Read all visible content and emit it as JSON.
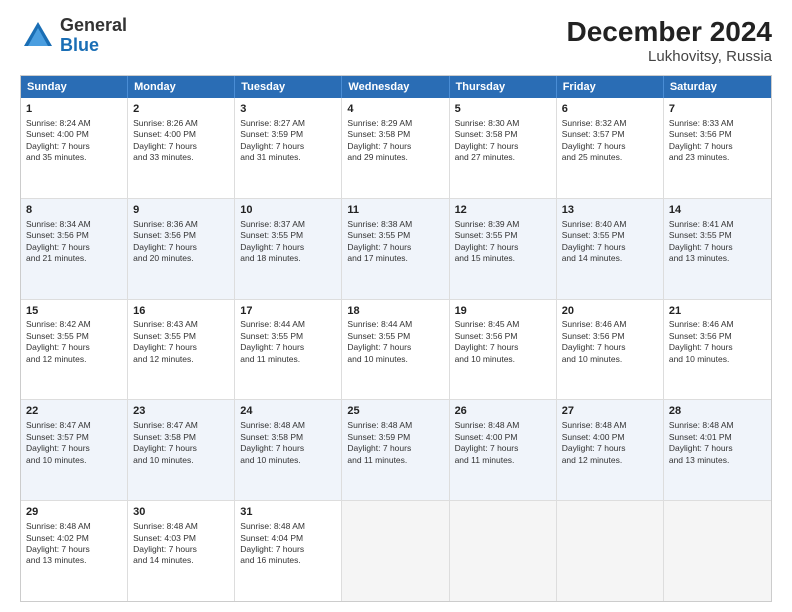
{
  "header": {
    "logo": {
      "general": "General",
      "blue": "Blue"
    },
    "title": "December 2024",
    "location": "Lukhovitsy, Russia"
  },
  "days": [
    "Sunday",
    "Monday",
    "Tuesday",
    "Wednesday",
    "Thursday",
    "Friday",
    "Saturday"
  ],
  "weeks": [
    [
      {
        "day": "1",
        "lines": [
          "Sunrise: 8:24 AM",
          "Sunset: 4:00 PM",
          "Daylight: 7 hours",
          "and 35 minutes."
        ]
      },
      {
        "day": "2",
        "lines": [
          "Sunrise: 8:26 AM",
          "Sunset: 4:00 PM",
          "Daylight: 7 hours",
          "and 33 minutes."
        ]
      },
      {
        "day": "3",
        "lines": [
          "Sunrise: 8:27 AM",
          "Sunset: 3:59 PM",
          "Daylight: 7 hours",
          "and 31 minutes."
        ]
      },
      {
        "day": "4",
        "lines": [
          "Sunrise: 8:29 AM",
          "Sunset: 3:58 PM",
          "Daylight: 7 hours",
          "and 29 minutes."
        ]
      },
      {
        "day": "5",
        "lines": [
          "Sunrise: 8:30 AM",
          "Sunset: 3:58 PM",
          "Daylight: 7 hours",
          "and 27 minutes."
        ]
      },
      {
        "day": "6",
        "lines": [
          "Sunrise: 8:32 AM",
          "Sunset: 3:57 PM",
          "Daylight: 7 hours",
          "and 25 minutes."
        ]
      },
      {
        "day": "7",
        "lines": [
          "Sunrise: 8:33 AM",
          "Sunset: 3:56 PM",
          "Daylight: 7 hours",
          "and 23 minutes."
        ]
      }
    ],
    [
      {
        "day": "8",
        "lines": [
          "Sunrise: 8:34 AM",
          "Sunset: 3:56 PM",
          "Daylight: 7 hours",
          "and 21 minutes."
        ]
      },
      {
        "day": "9",
        "lines": [
          "Sunrise: 8:36 AM",
          "Sunset: 3:56 PM",
          "Daylight: 7 hours",
          "and 20 minutes."
        ]
      },
      {
        "day": "10",
        "lines": [
          "Sunrise: 8:37 AM",
          "Sunset: 3:55 PM",
          "Daylight: 7 hours",
          "and 18 minutes."
        ]
      },
      {
        "day": "11",
        "lines": [
          "Sunrise: 8:38 AM",
          "Sunset: 3:55 PM",
          "Daylight: 7 hours",
          "and 17 minutes."
        ]
      },
      {
        "day": "12",
        "lines": [
          "Sunrise: 8:39 AM",
          "Sunset: 3:55 PM",
          "Daylight: 7 hours",
          "and 15 minutes."
        ]
      },
      {
        "day": "13",
        "lines": [
          "Sunrise: 8:40 AM",
          "Sunset: 3:55 PM",
          "Daylight: 7 hours",
          "and 14 minutes."
        ]
      },
      {
        "day": "14",
        "lines": [
          "Sunrise: 8:41 AM",
          "Sunset: 3:55 PM",
          "Daylight: 7 hours",
          "and 13 minutes."
        ]
      }
    ],
    [
      {
        "day": "15",
        "lines": [
          "Sunrise: 8:42 AM",
          "Sunset: 3:55 PM",
          "Daylight: 7 hours",
          "and 12 minutes."
        ]
      },
      {
        "day": "16",
        "lines": [
          "Sunrise: 8:43 AM",
          "Sunset: 3:55 PM",
          "Daylight: 7 hours",
          "and 12 minutes."
        ]
      },
      {
        "day": "17",
        "lines": [
          "Sunrise: 8:44 AM",
          "Sunset: 3:55 PM",
          "Daylight: 7 hours",
          "and 11 minutes."
        ]
      },
      {
        "day": "18",
        "lines": [
          "Sunrise: 8:44 AM",
          "Sunset: 3:55 PM",
          "Daylight: 7 hours",
          "and 10 minutes."
        ]
      },
      {
        "day": "19",
        "lines": [
          "Sunrise: 8:45 AM",
          "Sunset: 3:56 PM",
          "Daylight: 7 hours",
          "and 10 minutes."
        ]
      },
      {
        "day": "20",
        "lines": [
          "Sunrise: 8:46 AM",
          "Sunset: 3:56 PM",
          "Daylight: 7 hours",
          "and 10 minutes."
        ]
      },
      {
        "day": "21",
        "lines": [
          "Sunrise: 8:46 AM",
          "Sunset: 3:56 PM",
          "Daylight: 7 hours",
          "and 10 minutes."
        ]
      }
    ],
    [
      {
        "day": "22",
        "lines": [
          "Sunrise: 8:47 AM",
          "Sunset: 3:57 PM",
          "Daylight: 7 hours",
          "and 10 minutes."
        ]
      },
      {
        "day": "23",
        "lines": [
          "Sunrise: 8:47 AM",
          "Sunset: 3:58 PM",
          "Daylight: 7 hours",
          "and 10 minutes."
        ]
      },
      {
        "day": "24",
        "lines": [
          "Sunrise: 8:48 AM",
          "Sunset: 3:58 PM",
          "Daylight: 7 hours",
          "and 10 minutes."
        ]
      },
      {
        "day": "25",
        "lines": [
          "Sunrise: 8:48 AM",
          "Sunset: 3:59 PM",
          "Daylight: 7 hours",
          "and 11 minutes."
        ]
      },
      {
        "day": "26",
        "lines": [
          "Sunrise: 8:48 AM",
          "Sunset: 4:00 PM",
          "Daylight: 7 hours",
          "and 11 minutes."
        ]
      },
      {
        "day": "27",
        "lines": [
          "Sunrise: 8:48 AM",
          "Sunset: 4:00 PM",
          "Daylight: 7 hours",
          "and 12 minutes."
        ]
      },
      {
        "day": "28",
        "lines": [
          "Sunrise: 8:48 AM",
          "Sunset: 4:01 PM",
          "Daylight: 7 hours",
          "and 13 minutes."
        ]
      }
    ],
    [
      {
        "day": "29",
        "lines": [
          "Sunrise: 8:48 AM",
          "Sunset: 4:02 PM",
          "Daylight: 7 hours",
          "and 13 minutes."
        ]
      },
      {
        "day": "30",
        "lines": [
          "Sunrise: 8:48 AM",
          "Sunset: 4:03 PM",
          "Daylight: 7 hours",
          "and 14 minutes."
        ]
      },
      {
        "day": "31",
        "lines": [
          "Sunrise: 8:48 AM",
          "Sunset: 4:04 PM",
          "Daylight: 7 hours",
          "and 16 minutes."
        ]
      },
      {
        "day": "",
        "lines": []
      },
      {
        "day": "",
        "lines": []
      },
      {
        "day": "",
        "lines": []
      },
      {
        "day": "",
        "lines": []
      }
    ]
  ]
}
